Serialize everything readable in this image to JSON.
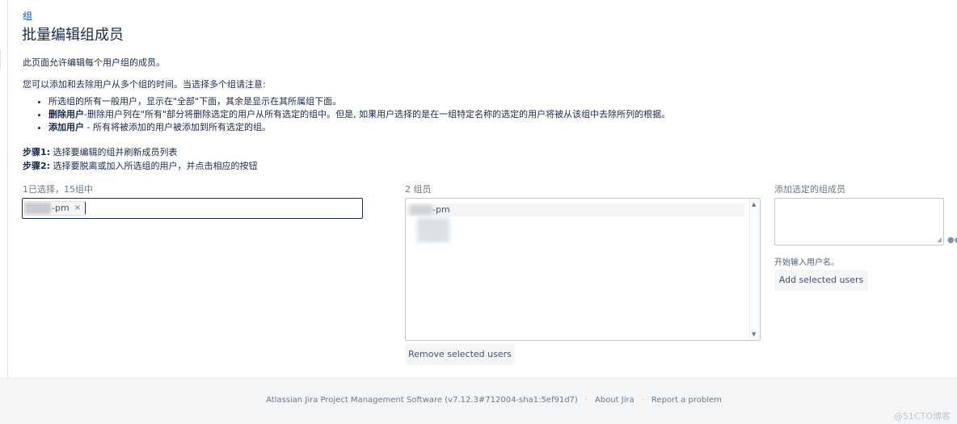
{
  "breadcrumb": "组",
  "title": "批量编辑组成员",
  "intro": "此页面允许编辑每个用户组的成员。",
  "notice": "您可以添加和去除用户从多个组的时间。当选择多个组请注意:",
  "notes": [
    {
      "bold": "",
      "text": "所选组的所有一般用户，显示在\"全部\"下面，其余是显示在其所属组下面。"
    },
    {
      "bold": "删除用户",
      "text": "-删除用户列在\"所有\"部分将删除选定的用户从所有选定的组中。但是, 如果用户选择的是在一组特定名称的选定的用户将被从该组中去除所列的根据。"
    },
    {
      "bold": "添加用户",
      "text": " - 所有将被添加的用户被添加到所有选定的组。"
    }
  ],
  "steps": [
    {
      "label": "步骤1:",
      "text": "  选择要编辑的组并刷新成员列表"
    },
    {
      "label": "步骤2:",
      "text": "  选择要脱离或加入所选组的用户，并点击相应的按钮"
    }
  ],
  "group_picker": {
    "label": "1已选择，15组中",
    "chip_suffix": "-pm",
    "chip_remove": "×"
  },
  "members": {
    "label": "2 组员",
    "rows": [
      "-pm"
    ],
    "scroll_up": "▲",
    "scroll_down": "▼",
    "remove_button": "Remove selected users"
  },
  "add_members": {
    "label": "添加选定的组成员",
    "hint": "开始输入用户名。",
    "add_button": "Add selected users"
  },
  "footer": {
    "version": "Atlassian Jira Project Management Software (v7.12.3#712004-sha1:5ef91d7)",
    "sep": "·",
    "about": "About Jira",
    "report": "Report a problem",
    "watermark": "@51CTO博客"
  }
}
